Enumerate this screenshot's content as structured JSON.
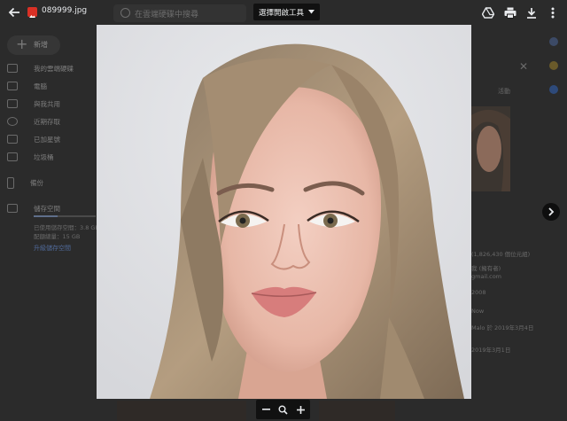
{
  "viewer": {
    "file_name": "089999.jpg",
    "open_with_label": "選擇開啟工具",
    "icons": [
      "back-arrow-icon",
      "image-file-icon",
      "drive-icon",
      "print-icon",
      "download-icon",
      "more-vert-icon",
      "chevron-right-icon",
      "zoom-out-icon",
      "zoom-reset-icon",
      "zoom-in-icon"
    ]
  },
  "background": {
    "search_placeholder": "在雲端硬碟中搜尋",
    "new_button": "新增",
    "sidebar": [
      {
        "label": "我的雲端硬碟",
        "icon": "drive-folder-icon"
      },
      {
        "label": "電腦",
        "icon": "computer-icon"
      },
      {
        "label": "與我共用",
        "icon": "shared-icon"
      },
      {
        "label": "近期存取",
        "icon": "clock-icon"
      },
      {
        "label": "已加星號",
        "icon": "star-icon"
      },
      {
        "label": "垃圾桶",
        "icon": "trash-icon"
      },
      {
        "label": "備份",
        "icon": "phone-icon"
      },
      {
        "label": "儲存空間",
        "icon": "storage-icon"
      }
    ],
    "storage_used_text": "已使用儲存空間：3.8 GB",
    "storage_quota_text": "配額總量：15 GB",
    "storage_link": "升級儲存空間",
    "details_panel": {
      "tab": "活動",
      "lines": [
        "(1,826,430 個位元組)",
        "我 (擁有者)",
        "gmail.com",
        "2008",
        "Now",
        "Malo 於 2019年3月4日",
        "2019年3月1日"
      ]
    }
  }
}
